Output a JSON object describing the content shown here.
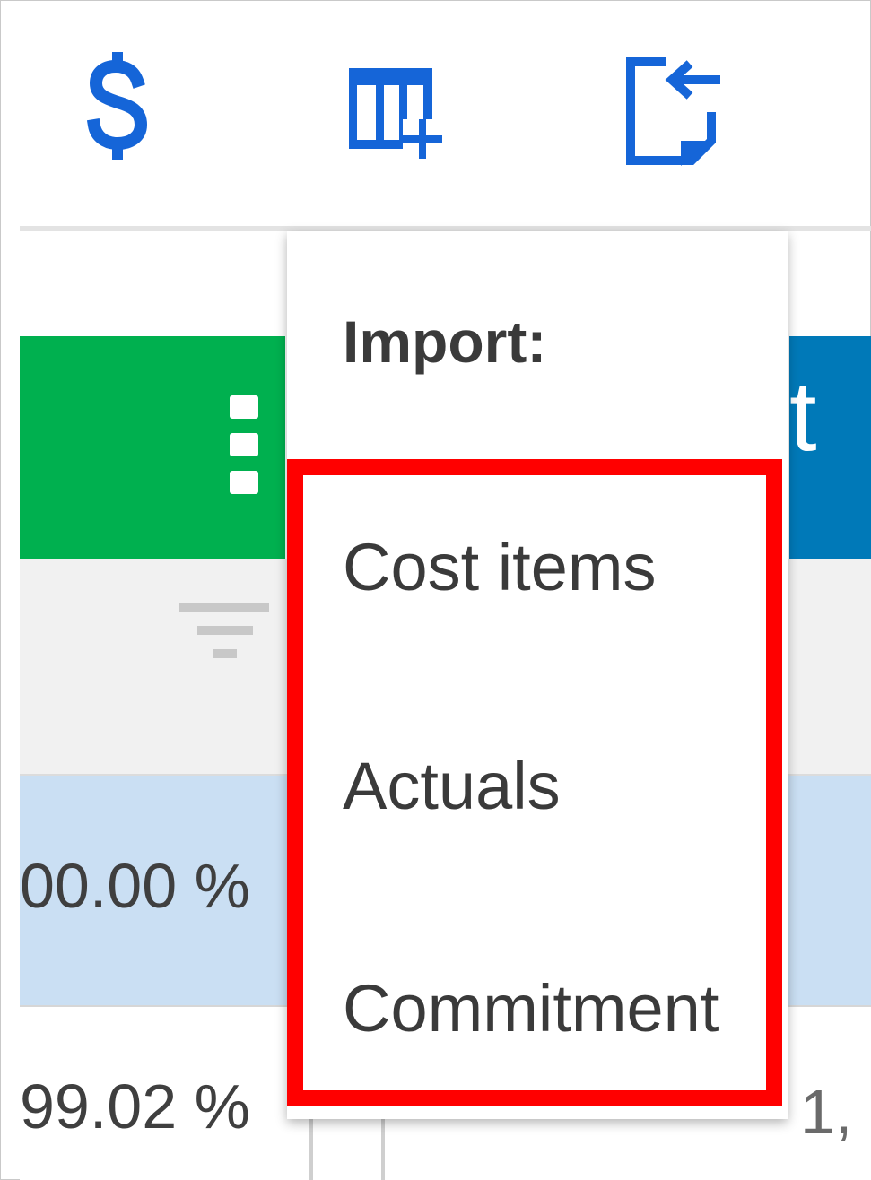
{
  "toolbar": {
    "icons": [
      "dollar-icon",
      "add-column-icon",
      "import-file-icon"
    ],
    "icon_color": "#1565d8"
  },
  "grid": {
    "green_header_color": "#00b04f",
    "blue_header_color": "#0079b8",
    "blue_header_text_fragment": "t",
    "row1_percent": "00.00 %",
    "row2_percent": "99.02 %",
    "row2_right_fragment": "1,",
    "row_highlight_color": "#cadff3"
  },
  "menu": {
    "title": "Import:",
    "items": [
      "Cost items",
      "Actuals",
      "Commitment"
    ],
    "highlight_color": "#ff0000"
  }
}
